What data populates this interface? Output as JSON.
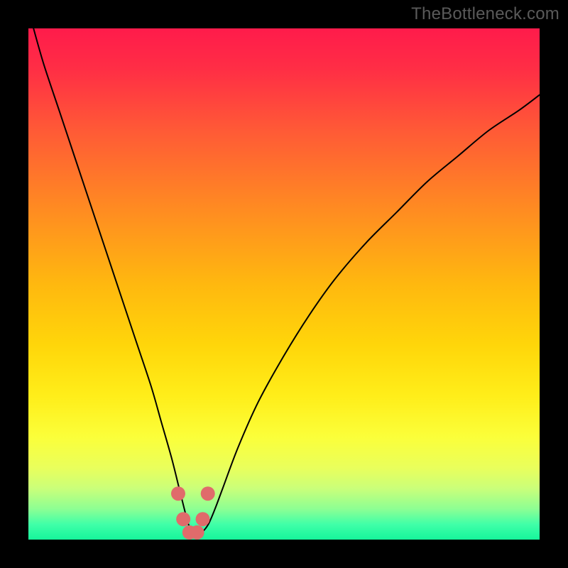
{
  "watermark": "TheBottleneck.com",
  "chart_data": {
    "type": "line",
    "title": "",
    "xlabel": "",
    "ylabel": "",
    "xlim": [
      0,
      100
    ],
    "ylim": [
      0,
      100
    ],
    "grid": false,
    "legend": false,
    "background_gradient_stops": [
      {
        "offset": 0.0,
        "color": "#ff1b4b"
      },
      {
        "offset": 0.08,
        "color": "#ff2e45"
      },
      {
        "offset": 0.2,
        "color": "#ff5a36"
      },
      {
        "offset": 0.35,
        "color": "#ff8a22"
      },
      {
        "offset": 0.5,
        "color": "#ffb80f"
      },
      {
        "offset": 0.62,
        "color": "#ffd60a"
      },
      {
        "offset": 0.72,
        "color": "#ffee1a"
      },
      {
        "offset": 0.8,
        "color": "#fbff3a"
      },
      {
        "offset": 0.86,
        "color": "#e9ff5c"
      },
      {
        "offset": 0.9,
        "color": "#caff7a"
      },
      {
        "offset": 0.94,
        "color": "#8dff93"
      },
      {
        "offset": 0.97,
        "color": "#40ffa8"
      },
      {
        "offset": 1.0,
        "color": "#16f59b"
      }
    ],
    "series": [
      {
        "name": "bottleneck-curve",
        "color": "#000000",
        "stroke_width": 2,
        "x": [
          1,
          3,
          6,
          9,
          12,
          15,
          18,
          21,
          24,
          26,
          28,
          29.5,
          30.5,
          31.3,
          32.2,
          33.0,
          34.0,
          35.2,
          36.5,
          38.0,
          41,
          45,
          50,
          55,
          60,
          66,
          72,
          78,
          84,
          90,
          96,
          100
        ],
        "y": [
          100,
          93,
          84,
          75,
          66,
          57,
          48,
          39,
          30,
          23,
          16,
          10,
          6,
          3,
          1.5,
          1.2,
          1.5,
          3,
          6,
          10,
          18,
          27,
          36,
          44,
          51,
          58,
          64,
          70,
          75,
          80,
          84,
          87
        ]
      }
    ],
    "markers": {
      "name": "highlight-points",
      "color": "#e06b6b",
      "radius": 10,
      "points": [
        {
          "x": 29.3,
          "y": 9
        },
        {
          "x": 30.3,
          "y": 4
        },
        {
          "x": 31.5,
          "y": 1.4
        },
        {
          "x": 33.0,
          "y": 1.4
        },
        {
          "x": 34.1,
          "y": 4
        },
        {
          "x": 35.1,
          "y": 9
        }
      ]
    }
  }
}
